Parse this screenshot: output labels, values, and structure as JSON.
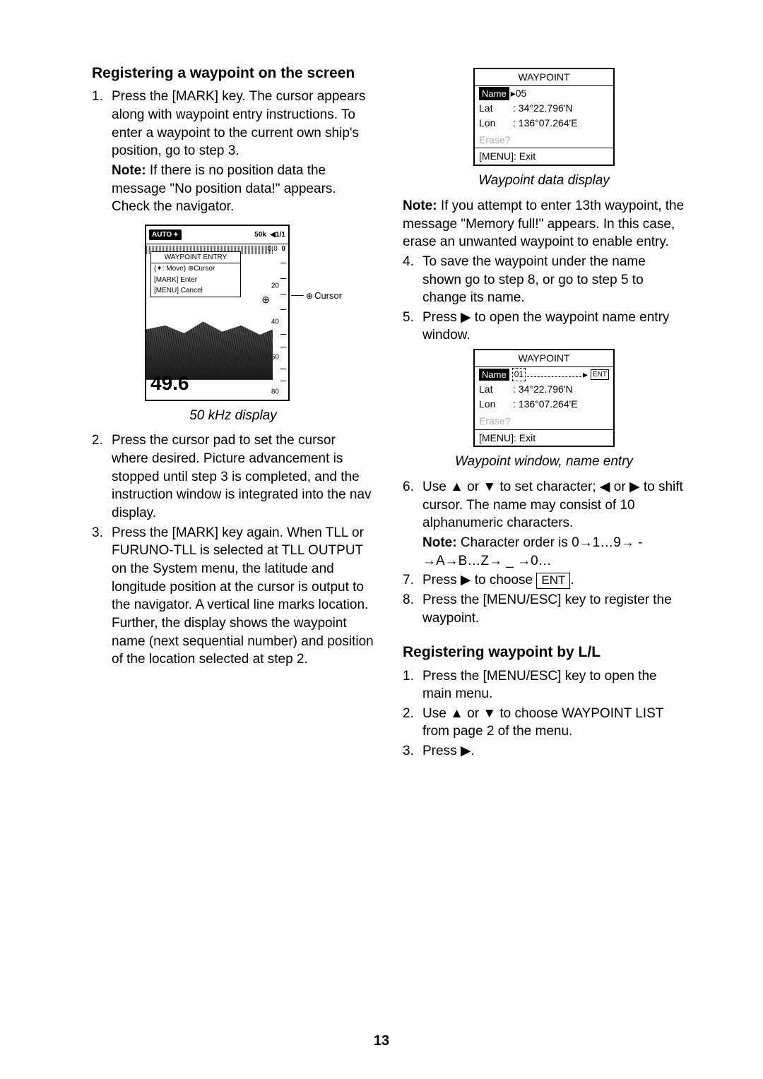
{
  "page_number": "13",
  "left": {
    "heading": "Registering a waypoint on the screen",
    "step1_num": "1.",
    "step1": "Press the [MARK] key. The cursor appears along with waypoint entry instructions. To enter a waypoint to the current own ship's position, go to step 3.",
    "note1_lead": "Note:",
    "note1": " If there is no position data the message \"No position data!\" appears. Check the navigator.",
    "fig1": {
      "auto": "AUTO",
      "range": "50k",
      "page": "1/1",
      "zero_left": "0.0",
      "zero_right": "0",
      "entry_title": "WAYPOINT ENTRY",
      "entry_move": "(✦: Move) ⊕Cursor",
      "entry_enter": "[MARK] Enter",
      "entry_cancel": "[MENU] Cancel",
      "t20": "20",
      "t40": "40",
      "t60": "60",
      "t80": "80",
      "depth": "49.6",
      "cursor_label": "Cursor"
    },
    "fig1_caption": "50 kHz display",
    "step2_num": "2.",
    "step2": "Press the cursor pad to set the cursor where desired. Picture advancement is stopped until step 3 is completed, and the instruction window is integrated into the nav display.",
    "step3_num": "3.",
    "step3": "Press the [MARK] key again. When TLL or FURUNO-TLL is selected at TLL OUTPUT on the System menu, the latitude and longitude position at the cursor is output to the navigator. A vertical line marks location. Further, the display shows the waypoint name (next sequential number) and position of the location selected at step 2."
  },
  "right": {
    "wp1": {
      "title": "WAYPOINT",
      "name_label": "Name",
      "name_arrow": "▸",
      "name_val": "05",
      "lat_label": "Lat",
      "lat_val": ":  34°22.796'N",
      "lon_label": "Lon",
      "lon_val": ": 136°07.264'E",
      "erase": "Erase?",
      "exit": "[MENU]: Exit"
    },
    "wp1_caption": "Waypoint data display",
    "note2_lead": "Note:",
    "note2": " If you attempt to enter 13th waypoint, the message \"Memory full!\" appears. In this case, erase an unwanted waypoint to enable entry.",
    "step4_num": "4.",
    "step4": "To save the waypoint under the name shown go to step 8, or go to step 5 to change its name.",
    "step5_num": "5.",
    "step5": "Press ▶ to open the waypoint name entry window.",
    "wp2": {
      "title": "WAYPOINT",
      "name_label": "Name",
      "name_val": "01",
      "ent": "ENT",
      "lat_label": "Lat",
      "lat_val": ":  34°22.796'N",
      "lon_label": "Lon",
      "lon_val": ": 136°07.264'E",
      "erase": "Erase?",
      "exit": "[MENU]: Exit"
    },
    "wp2_caption": "Waypoint window, name entry",
    "step6_num": "6.",
    "step6": "Use ▲ or ▼ to set character; ◀ or ▶ to shift cursor. The name may consist of 10 alphanumeric characters.",
    "note3_lead": "Note:",
    "note3": " Character order is 0→1…9→ - →A→B…Z→ _ →0…",
    "step7_num": "7.",
    "step7_pre": "Press ▶ to choose ",
    "step7_ent": "ENT",
    "step7_post": ".",
    "step8_num": "8.",
    "step8": "Press the [MENU/ESC] key to register the waypoint.",
    "heading2": "Registering waypoint by L/L",
    "ll1_num": "1.",
    "ll1": "Press the [MENU/ESC] key to open the main menu.",
    "ll2_num": "2.",
    "ll2": "Use ▲ or ▼ to choose WAYPOINT LIST from page 2 of the menu.",
    "ll3_num": "3.",
    "ll3": "Press ▶."
  }
}
